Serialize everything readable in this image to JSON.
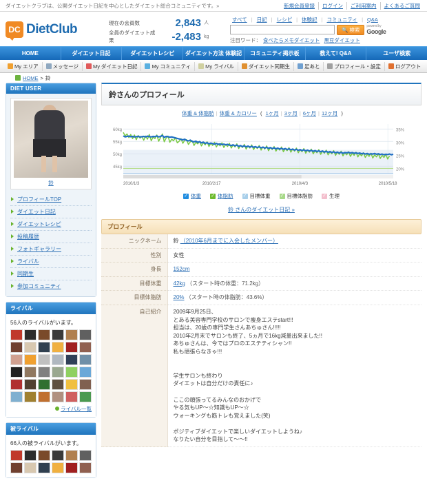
{
  "topbar": {
    "tagline": "ダイエットクラブは、公開ダイエット日記を中心としたダイエット総合コミュニティです。»",
    "links": [
      {
        "label": "新規会員登録"
      },
      {
        "label": "ログイン"
      },
      {
        "label": "ご利用案内"
      },
      {
        "label": "よくあるご質問"
      }
    ]
  },
  "header": {
    "logo_mark": "DC",
    "logo_text": "DietClub",
    "stats": [
      {
        "label": "現在の会員数",
        "value": "2,843",
        "unit": "人"
      },
      {
        "label": "全員のダイエット成果",
        "value": "-2,483",
        "unit": "kg"
      }
    ],
    "search": {
      "categories": [
        "すべて",
        "日記",
        "レシピ",
        "体験記",
        "コミュニティ",
        "Q&A"
      ],
      "input_value": "",
      "placeholder": "",
      "button_label": "検索",
      "button_icon": "search-icon",
      "google_powered_small": "powered by",
      "google_label": "Google",
      "keyword_label": "注目ワード：",
      "keywords": [
        "食べたらメモダイエット",
        "黒豆ダイエット"
      ]
    }
  },
  "global_nav": [
    {
      "label": "HOME"
    },
    {
      "label": "ダイエット日記"
    },
    {
      "label": "ダイエットレシピ"
    },
    {
      "label": "ダイエット方法 体験記"
    },
    {
      "label": "コミュニティ掲示板"
    },
    {
      "label": "教えて! Q&A"
    },
    {
      "label": "ユーザ検索"
    }
  ],
  "member_nav": [
    {
      "label": "My エリア",
      "icon": "user-icon",
      "color": "#f0a030"
    },
    {
      "label": "メッセージ",
      "icon": "mail-icon",
      "color": "#8fa8c0"
    },
    {
      "label": "My ダイエット日記",
      "icon": "notebook-icon",
      "color": "#e05a5a"
    },
    {
      "label": "My コミュニティ",
      "icon": "community-icon",
      "color": "#5ab0e0"
    },
    {
      "label": "My ライバル",
      "icon": "tag-icon",
      "color": "#d0d0a0"
    },
    {
      "label": "ダイエット同期生",
      "icon": "group-icon",
      "color": "#e09030"
    },
    {
      "label": "足あと",
      "icon": "footprint-icon",
      "color": "#70a0d0"
    },
    {
      "label": "プロフィール・設定",
      "icon": "wrench-icon",
      "color": "#a0a0a0"
    },
    {
      "label": "ログアウト",
      "icon": "logout-icon",
      "color": "#e07030"
    }
  ],
  "breadcrumb": {
    "home_icon": "home-icon",
    "home_label": "HOME",
    "separator": ">",
    "current": "鈴"
  },
  "sidebar": {
    "user_panel": {
      "title": "DIET USER",
      "avatar_name": "鈴"
    },
    "menu": [
      {
        "label": "プロフィールTOP"
      },
      {
        "label": "ダイエット日記"
      },
      {
        "label": "ダイエットレシピ"
      },
      {
        "label": "投稿履歴"
      },
      {
        "label": "フォトギャラリー"
      },
      {
        "label": "ライバル"
      },
      {
        "label": "同期生"
      },
      {
        "label": "参加コミュニティ"
      }
    ],
    "rival_panel": {
      "title": "ライバル",
      "count_text": "56人のライバルがいます。",
      "more_label": "ライバル一覧",
      "thumb_colors": [
        "#c0392b",
        "#2c2c2c",
        "#7a4a2a",
        "#3a3a3a",
        "#b08050",
        "#606060",
        "#704030",
        "#d8c8b0",
        "#304050",
        "#f0b040",
        "#a02020",
        "#906050",
        "#d0a090",
        "#f0a030",
        "#c0c0c0",
        "#b0b8c0",
        "#304058",
        "#7090a8",
        "#202020",
        "#907860",
        "#808080",
        "#9aa890",
        "#8fd060",
        "#6aa8d8",
        "#b03030",
        "#504030",
        "#307030",
        "#605040",
        "#f0c040",
        "#806050",
        "#80b0d0",
        "#a08030",
        "#c07030",
        "#b09080",
        "#d06060",
        "#4a9a50"
      ]
    },
    "reverse_rival_panel": {
      "title": "被ライバル",
      "count_text": "66人の被ライバルがいます。"
    }
  },
  "main": {
    "page_title": "鈴さんのプロフィール",
    "chart_tabs": {
      "items": [
        "体重 & 体脂肪",
        "体重 & カロリー"
      ],
      "open_paren": "(",
      "ranges": [
        "1ヶ月",
        "3ヶ月",
        "6ヶ月",
        "12ヶ月"
      ],
      "close_paren": ")"
    },
    "diary_link": "鈴 さんのダイエット日記 »",
    "profile_section_title": "プロフィール",
    "profile_rows": [
      {
        "label": "ニックネーム",
        "value": "鈴",
        "link": "（2010年6月までに入会したメンバー）"
      },
      {
        "label": "性別",
        "value": "女性",
        "link": ""
      },
      {
        "label": "身長",
        "value": "",
        "link": "152cm"
      },
      {
        "label": "目標体重",
        "value": "",
        "link": "42kg",
        "note": "（スタート時の体重：71.2kg）"
      },
      {
        "label": "目標体脂肪",
        "value": "",
        "link": "20%",
        "note": "（スタート時の体脂肪：43.6%）"
      },
      {
        "label": "自己紹介",
        "value": "",
        "link": ""
      }
    ],
    "bio_text": "2009年9月25日、\nとある美容専門学校のサロンで痩身エステstart!!!\n担当は、20歳の専門学生さんあちゅさん!!!!!\n2010年2月末でサロンも終了、5ヵ月で16kg減量出来ました!!\nあちゅさんは、今ではプロのエステティシャン!!\n私も頑張らなきゃ!!!\n\n\n学生サロンも終わり\nダイエットは自分だけの責任に♪\n\nここの頑張ってるみんなのおかげで\nやる気もUP〜☆知識もUP〜☆\nウォーキングも筋トレも覚えました(笑)\n\nポジティブダイエットで楽しいダイエットしようね♪\nなりたい自分を目指して〜〜!!"
  },
  "chart_data": {
    "type": "line",
    "title": "",
    "xlabel": "",
    "ylabel_left": "kg",
    "ylabel_right": "%",
    "x_ticks": [
      "2010/1/3",
      "2010/2/17",
      "2010/4/3",
      "2010/5/18"
    ],
    "y_left_ticks": [
      "60kg",
      "55kg",
      "50kg",
      "45kg"
    ],
    "y_right_ticks": [
      "35%",
      "30%",
      "25%",
      "20%"
    ],
    "ylim_left": [
      42,
      62
    ],
    "ylim_right": [
      18,
      37
    ],
    "grid": true,
    "legend_position": "bottom",
    "series": [
      {
        "name": "体重",
        "color": "#1f6fc4",
        "axis": "left",
        "values": [
          57.2,
          56.8,
          57.0,
          57.1,
          56.9,
          57.0,
          56.8,
          56.9,
          57.0,
          56.8,
          56.9,
          57.0,
          56.8,
          57.1,
          56.9,
          56.8,
          57.0,
          56.9,
          57.2,
          56.8,
          57.0,
          57.4,
          56.6,
          57.0,
          56.9,
          56.7,
          56.8,
          56.6,
          56.4,
          56.2,
          56.0,
          55.8,
          55.6,
          55.9,
          55.4,
          55.2,
          55.5,
          55.0,
          54.8,
          55.1,
          54.6,
          54.9,
          54.4,
          54.7,
          54.2,
          54.5,
          54.0,
          54.3,
          54.1,
          53.9,
          54.2,
          53.8,
          54.0,
          53.7,
          53.9,
          53.6,
          53.8,
          53.5,
          53.3,
          53.6,
          53.2,
          53.5,
          53.0,
          53.3,
          52.9,
          53.2,
          52.8,
          53.1,
          52.7,
          53.0,
          52.6,
          52.9,
          52.5,
          52.8,
          52.4,
          52.7,
          52.3,
          52.6,
          52.2,
          52.5,
          52.1,
          52.4,
          52.0,
          52.3,
          51.9,
          52.2,
          51.8,
          52.1,
          51.7,
          52.0,
          51.6,
          51.9,
          51.5,
          51.8,
          51.4,
          51.7,
          51.3,
          51.6,
          51.2,
          51.5,
          51.1,
          51.4,
          51.0,
          51.3,
          50.9,
          51.2,
          50.8,
          51.1,
          50.7,
          51.0,
          50.6,
          50.9,
          50.5,
          50.8,
          50.4,
          50.7,
          50.3,
          50.6,
          50.2,
          50.5,
          50.4,
          50.6,
          50.3,
          50.5,
          50.2,
          50.4,
          50.1,
          50.3,
          50.0,
          50.2,
          49.9,
          50.1,
          49.8,
          50.0,
          49.9,
          50.1,
          49.8,
          50.0,
          49.7,
          49.9,
          49.6,
          49.8,
          49.7,
          49.9,
          49.6,
          49.8
        ]
      },
      {
        "name": "体脂肪",
        "color": "#7ac943",
        "axis": "right",
        "values": [
          33.8,
          32.4,
          33.2,
          31.8,
          33.0,
          31.4,
          32.8,
          31.0,
          32.6,
          31.6,
          32.2,
          30.8,
          32.4,
          31.2,
          33.0,
          30.6,
          32.0,
          31.4,
          32.8,
          30.4,
          31.8,
          33.2,
          30.2,
          31.6,
          32.4,
          30.0,
          31.2,
          30.6,
          31.8,
          29.8,
          30.4,
          31.4,
          29.6,
          30.8,
          31.0,
          29.2,
          30.2,
          30.6,
          28.8,
          30.0,
          29.4,
          30.4,
          28.6,
          29.8,
          29.0,
          30.2,
          28.4,
          29.6,
          28.8,
          30.0,
          28.2,
          29.4,
          28.6,
          29.8,
          28.0,
          29.2,
          28.4,
          29.6,
          27.8,
          29.0,
          28.2,
          29.4,
          27.6,
          28.8,
          28.0,
          29.2,
          27.4,
          28.6,
          27.8,
          29.0,
          27.2,
          28.4,
          27.6,
          28.8,
          27.0,
          28.2,
          27.4,
          28.6,
          26.8,
          28.0,
          27.2,
          28.4,
          26.6,
          27.8,
          27.0,
          28.2,
          26.4,
          27.6,
          26.8,
          28.0,
          26.2,
          27.4,
          26.6,
          27.8,
          26.0,
          27.2,
          26.4,
          27.6,
          25.8,
          27.0,
          26.2,
          27.4,
          25.6,
          26.8,
          26.0,
          27.2,
          25.4,
          26.6,
          25.8,
          27.0,
          25.2,
          26.4,
          25.6,
          26.8,
          25.0,
          26.2,
          25.4,
          26.6,
          24.8,
          26.0,
          25.2,
          26.4,
          24.6,
          25.8,
          25.0,
          26.2,
          24.4,
          25.6,
          24.8,
          26.0,
          24.2,
          25.4,
          24.6,
          25.8,
          24.0,
          25.2,
          24.4,
          25.6,
          23.8,
          25.0,
          24.2,
          25.4,
          23.6,
          24.8
        ]
      },
      {
        "name": "目標体重",
        "color": "#a8c8e8",
        "axis": "left",
        "constant": 42
      },
      {
        "name": "目標体脂肪",
        "color": "#b6dd8e",
        "axis": "right",
        "constant": 20
      },
      {
        "name": "生理",
        "color": "#f2b8c6",
        "axis": "none"
      }
    ],
    "legend": [
      {
        "label": "体重",
        "color": "#1f8ce0",
        "checked": true
      },
      {
        "label": "体脂肪",
        "color": "#6dbb2e",
        "checked": true
      },
      {
        "label": "目標体重",
        "color": "#a8cfea",
        "checked": true
      },
      {
        "label": "目標体脂肪",
        "color": "#a8d98a",
        "checked": true
      },
      {
        "label": "生理",
        "color": "#f3bfcd",
        "checked": true
      }
    ]
  }
}
